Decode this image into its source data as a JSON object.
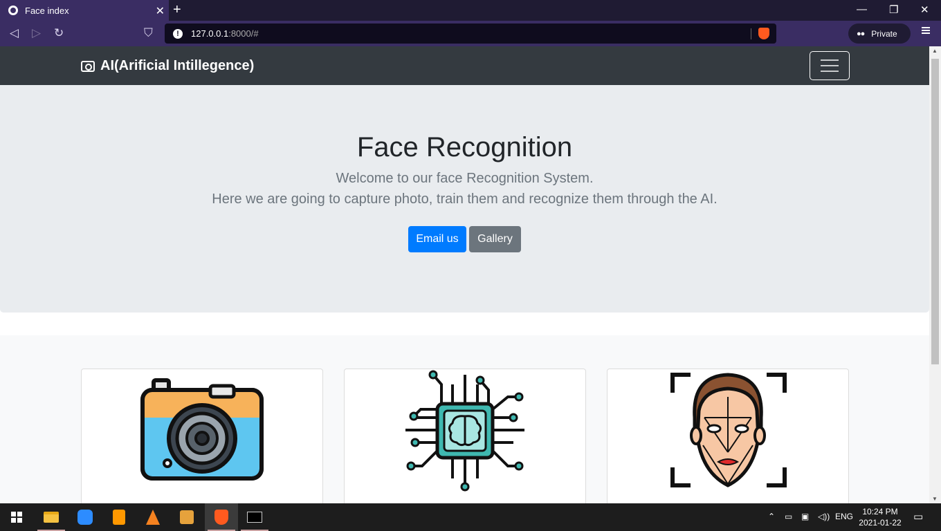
{
  "browser": {
    "tab_title": "Face index",
    "url_host": "127.0.0.1",
    "url_rest": ":8000/#",
    "private_label": "Private"
  },
  "site": {
    "brand": "AI(Arificial Intillegence)",
    "hero": {
      "title": "Face Recognition",
      "lead1": "Welcome to our face Recognition System.",
      "lead2": "Here we are going to capture photo, train them and recognize them through the AI.",
      "email_button": "Email us",
      "gallery_button": "Gallery"
    },
    "cards": [
      "camera-illustration",
      "ai-chip-illustration",
      "face-scan-illustration"
    ]
  },
  "taskbar": {
    "lang": "ENG",
    "time": "10:24 PM",
    "date": "2021-01-22"
  },
  "colors": {
    "primary": "#007bff",
    "secondary": "#6c757d",
    "navbar": "#343a40",
    "jumbotron": "#e9ecef"
  }
}
